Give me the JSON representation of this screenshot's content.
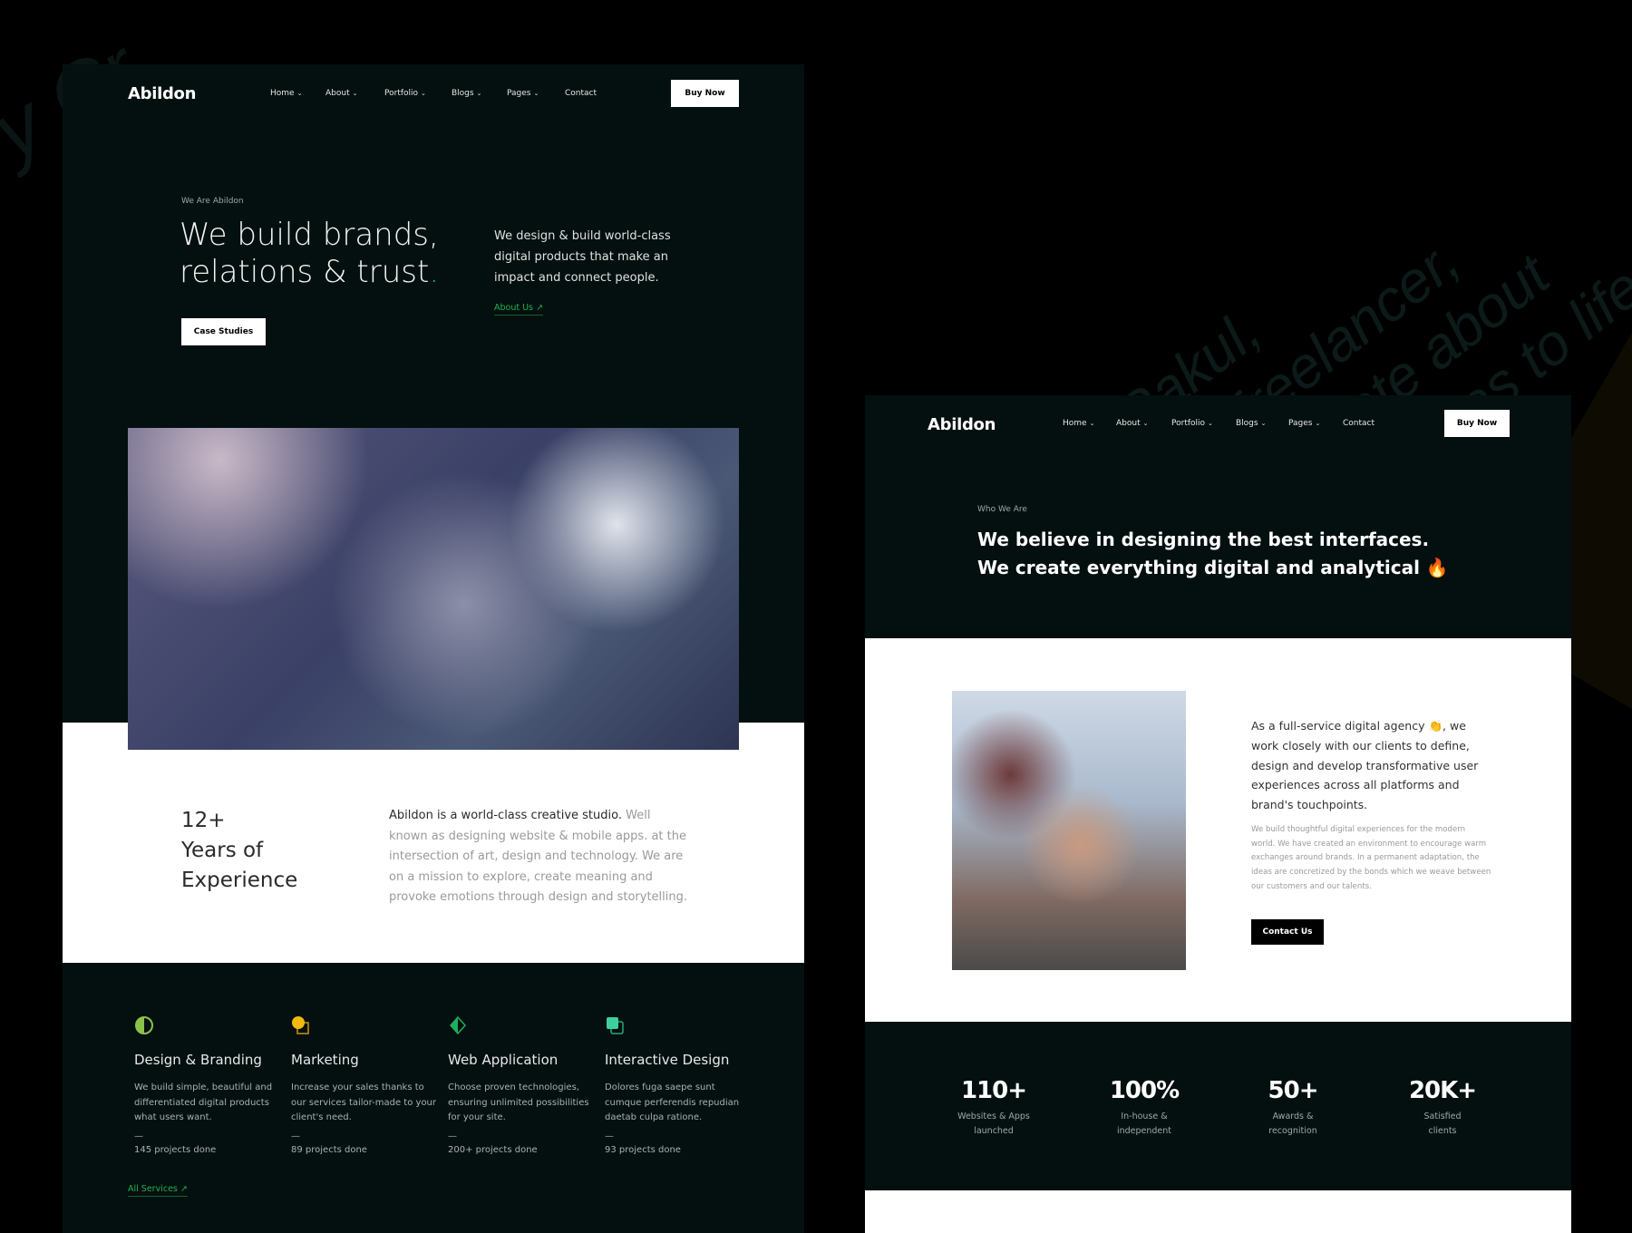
{
  "background_watermark": {
    "lines": [
      "Hi, I'm Rakul,",
      "A creative freelancer,",
      "who's passionate about",
      "bringing crazy ideas to life"
    ],
    "left_fragment": "y Cr"
  },
  "colors": {
    "panel_bg": "#03100f",
    "accent_green": "#22b24c",
    "white": "#ffffff"
  },
  "left_page": {
    "logo": "Abildon",
    "nav": [
      {
        "label": "Home",
        "dropdown": true
      },
      {
        "label": "About",
        "dropdown": true
      },
      {
        "label": "Portfolio",
        "dropdown": true
      },
      {
        "label": "Blogs",
        "dropdown": true
      },
      {
        "label": "Pages",
        "dropdown": true
      },
      {
        "label": "Contact",
        "dropdown": false
      }
    ],
    "buy_now": "Buy Now",
    "hero": {
      "eyebrow": "We Are Abildon",
      "headline_line1": "We build brands,",
      "headline_line2": "relations & trust",
      "headline_dot": ".",
      "description": "We design & build world-class digital products that make an impact and connect people.",
      "about_link": "About Us ↗",
      "case_studies": "Case Studies"
    },
    "experience": {
      "number": "12+",
      "line1": "Years of",
      "line2": "Experience"
    },
    "intro": {
      "lead": "Abildon is a world-class creative studio.",
      "rest": " Well known as designing website & mobile apps. at the intersection of art, design and technology. We are on a mission to explore, create meaning and provoke emotions through design and storytelling."
    },
    "services": [
      {
        "icon": "half-circle-icon",
        "color": "#8bc34a",
        "title": "Design & Branding",
        "desc": "We build simple, beautiful and differentiated digital products what users want.",
        "dash": "—",
        "count": "145 projects done"
      },
      {
        "icon": "circle-square-icon",
        "color": "#f0b90b",
        "title": "Marketing",
        "desc": "Increase your sales thanks to our services tailor-made to your client's need.",
        "dash": "—",
        "count": "89 projects done"
      },
      {
        "icon": "diamond-icon",
        "color": "#1fae5b",
        "title": "Web Application",
        "desc": "Choose proven technologies, ensuring unlimited possibilities for your site.",
        "dash": "—",
        "count": "200+ projects done"
      },
      {
        "icon": "stacked-squares-icon",
        "color": "#3ecf9f",
        "title": "Interactive Design",
        "desc": "Dolores fuga saepe sunt cumque perferendis repudian daetab culpa ratione.",
        "dash": "—",
        "count": "93 projects done"
      }
    ],
    "all_services": "All Services ↗"
  },
  "right_page": {
    "logo": "Abildon",
    "nav": [
      {
        "label": "Home",
        "dropdown": true
      },
      {
        "label": "About",
        "dropdown": true
      },
      {
        "label": "Portfolio",
        "dropdown": true
      },
      {
        "label": "Blogs",
        "dropdown": true
      },
      {
        "label": "Pages",
        "dropdown": true
      },
      {
        "label": "Contact",
        "dropdown": false
      }
    ],
    "buy_now": "Buy Now",
    "eyebrow": "Who We Are",
    "headline": "We believe in designing the best interfaces. We create everything digital and analytical 🔥",
    "about_lead": "As a full-service digital agency 👏, we work closely with our clients to define, design and develop transformative user experiences across all platforms and brand's touchpoints.",
    "about_body": "We build thoughtful digital experiences for the modern world. We have created an environment to encourage warm exchanges around brands. In a permanent adaptation, the ideas are concretized by the bonds which we weave between our customers and our talents.",
    "contact_us": "Contact Us",
    "stats": [
      {
        "value": "110+",
        "label": "Websites & Apps launched"
      },
      {
        "value": "100%",
        "label": "In-house & independent"
      },
      {
        "value": "50+",
        "label": "Awards & recognition"
      },
      {
        "value": "20K+",
        "label": "Satisfied clients"
      }
    ]
  }
}
